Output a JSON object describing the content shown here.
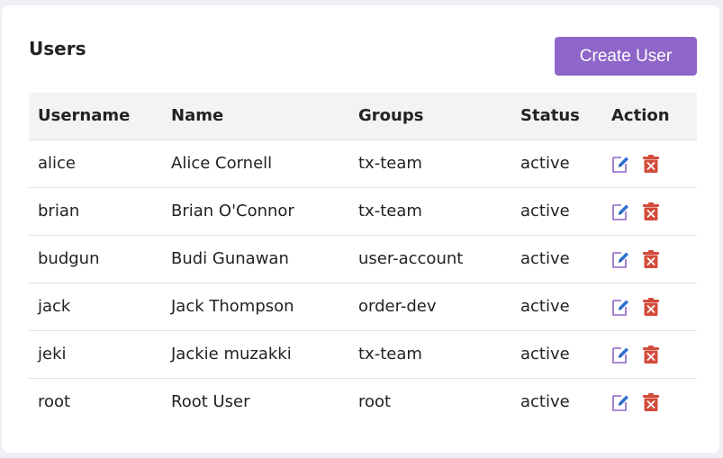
{
  "page": {
    "title": "Users",
    "create_button_label": "Create User"
  },
  "table": {
    "headers": {
      "username": "Username",
      "name": "Name",
      "groups": "Groups",
      "status": "Status",
      "action": "Action"
    },
    "rows": [
      {
        "username": "alice",
        "name": "Alice Cornell",
        "groups": "tx-team",
        "status": "active"
      },
      {
        "username": "brian",
        "name": "Brian O'Connor",
        "groups": "tx-team",
        "status": "active"
      },
      {
        "username": "budgun",
        "name": "Budi Gunawan",
        "groups": "user-account",
        "status": "active"
      },
      {
        "username": "jack",
        "name": "Jack Thompson",
        "groups": "order-dev",
        "status": "active"
      },
      {
        "username": "jeki",
        "name": "Jackie muzakki",
        "groups": "tx-team",
        "status": "active"
      },
      {
        "username": "root",
        "name": "Root User",
        "groups": "root",
        "status": "active"
      }
    ],
    "row_actions": [
      "edit-icon",
      "delete-icon"
    ]
  },
  "colors": {
    "accent": "#8e65c8",
    "edit_icon": "#2f6fd1",
    "delete_icon": "#d24b3b",
    "header_bg": "#f3f3f3",
    "page_bg": "#f1eef6"
  }
}
